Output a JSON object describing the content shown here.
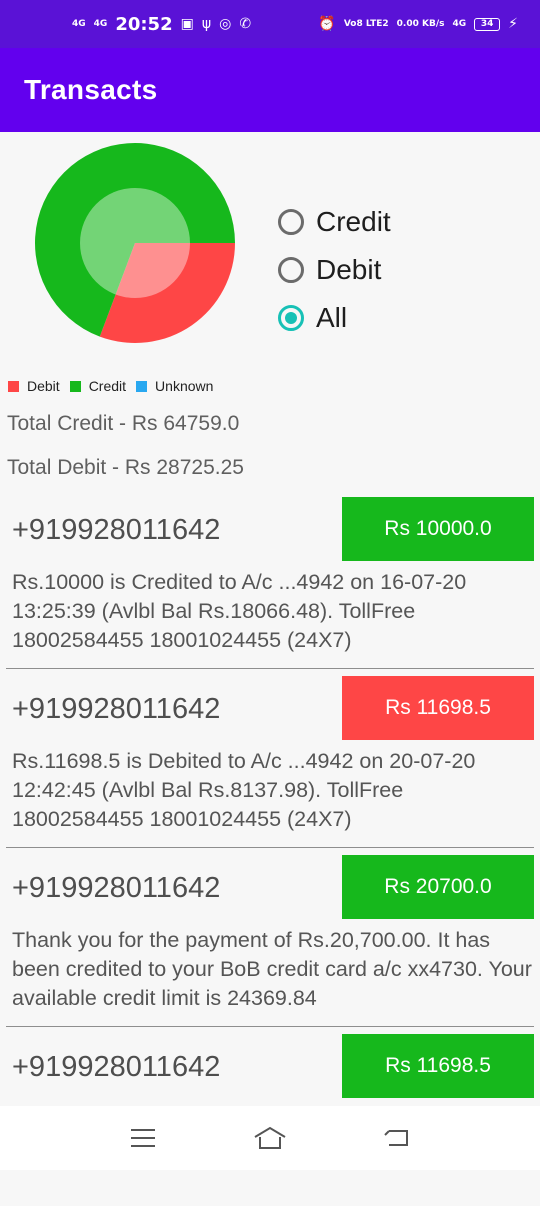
{
  "status_bar": {
    "network_1": "4G",
    "network_2": "4G",
    "time": "20:52",
    "volte": "Vo8 LTE2",
    "speed": "0.00 KB/s",
    "network_3": "4G",
    "battery": "34"
  },
  "app_bar": {
    "title": "Transacts"
  },
  "colors": {
    "primary": "#6200ee",
    "status": "#5a12d6",
    "credit": "#16b81c",
    "debit": "#fe4646",
    "unknown": "#29a8f0",
    "radio_accent": "#17c1b6"
  },
  "filter": {
    "options": [
      {
        "label": "Credit",
        "checked": false
      },
      {
        "label": "Debit",
        "checked": false
      },
      {
        "label": "All",
        "checked": true
      }
    ]
  },
  "chart_data": {
    "type": "pie",
    "categories": [
      "Debit",
      "Credit",
      "Unknown"
    ],
    "values": [
      28725.25,
      64759.0,
      0
    ],
    "colors": [
      "#fe4646",
      "#16b81c",
      "#29a8f0"
    ],
    "legend_position": "bottom-left"
  },
  "totals": {
    "credit": "Total Credit - Rs 64759.0",
    "debit": "Total Debit - Rs 28725.25"
  },
  "transactions": [
    {
      "phone": "+919928011642",
      "amount": "Rs 10000.0",
      "type": "credit",
      "message": "Rs.10000 is Credited to A/c ...4942 on 16-07-20 13:25:39 (Avlbl Bal Rs.18066.48). TollFree 18002584455 18001024455 (24X7)"
    },
    {
      "phone": "+919928011642",
      "amount": "Rs 11698.5",
      "type": "debit",
      "message": "Rs.11698.5 is Debited to A/c ...4942 on 20-07-20 12:42:45 (Avlbl Bal Rs.8137.98). TollFree 18002584455 18001024455 (24X7)"
    },
    {
      "phone": "+919928011642",
      "amount": "Rs 20700.0",
      "type": "credit",
      "message": "Thank you for the payment of Rs.20,700.00. It has been credited to your BoB credit card a/c xx4730. Your available credit limit is 24369.84"
    },
    {
      "phone": "+919928011642",
      "amount": "Rs 11698.5",
      "type": "credit",
      "message": ""
    }
  ],
  "nav": {
    "menu_icon": "menu-icon",
    "home_icon": "home-icon",
    "back_icon": "back-icon"
  }
}
